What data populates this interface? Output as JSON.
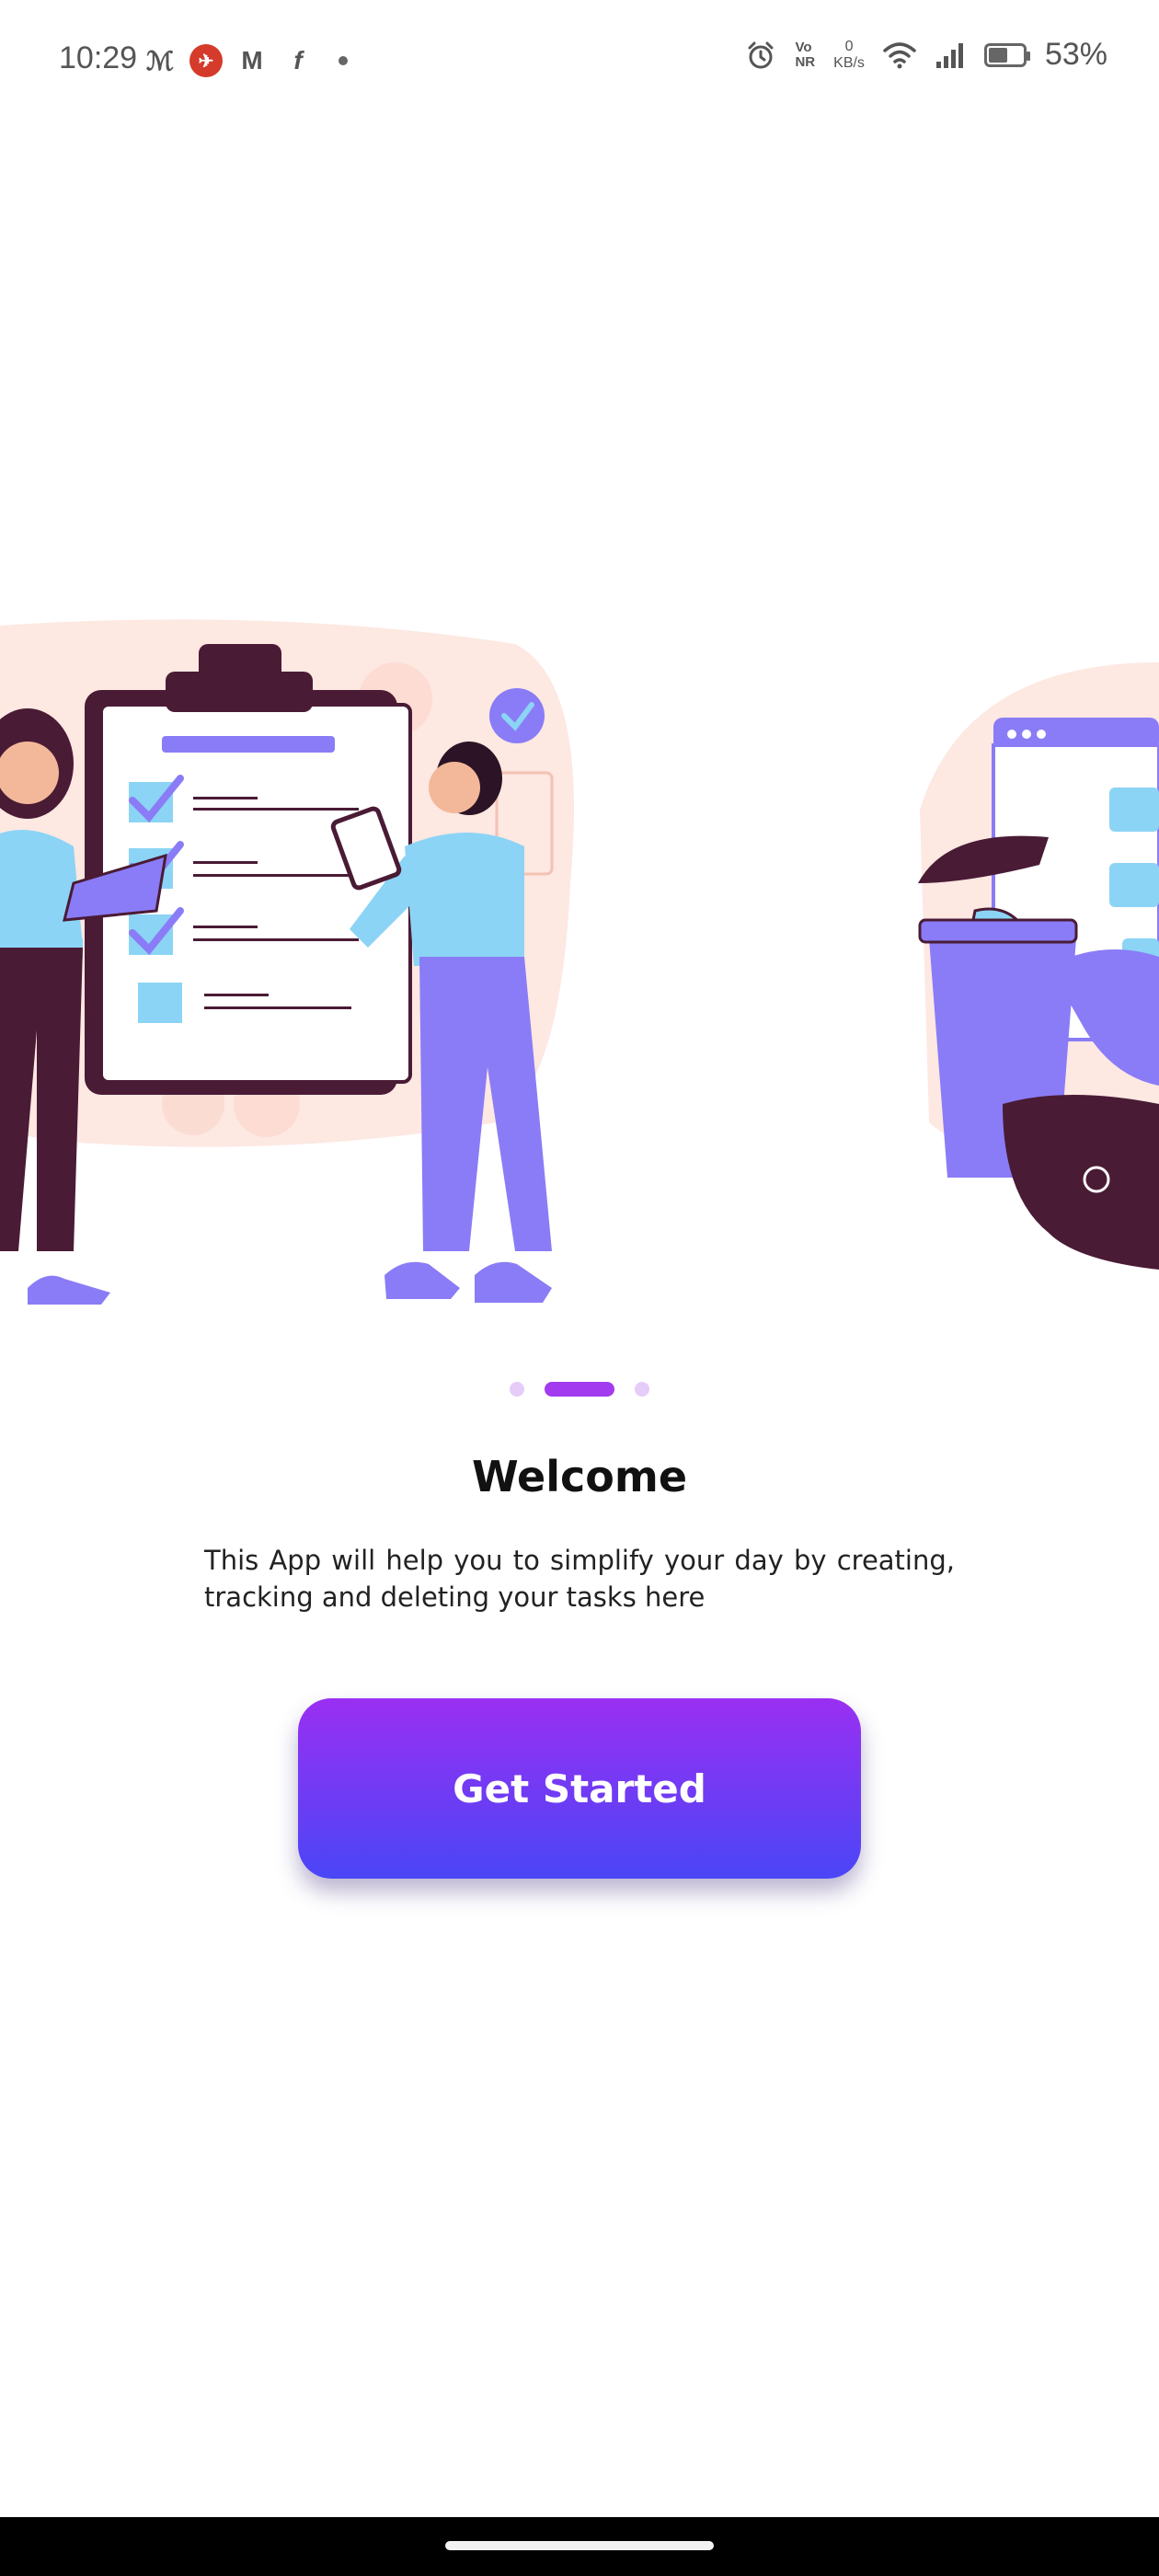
{
  "status_bar": {
    "time": "10:29",
    "app_icons": [
      {
        "name": "myntra-like-icon",
        "glyph": "ℳ",
        "color": "#555555"
      },
      {
        "name": "red-app-icon",
        "glyph": "✈",
        "color": "#d43b2a"
      },
      {
        "name": "m-app-icon",
        "glyph": "M",
        "color": "#555555"
      },
      {
        "name": "flipkart-icon",
        "glyph": "f",
        "color": "#555555"
      }
    ],
    "volte_top": "Vo",
    "volte_bottom": "NR",
    "net_speed_value": "0",
    "net_speed_unit": "KB/s",
    "battery_percent": "53%"
  },
  "onboarding": {
    "page_count": 3,
    "active_page": 2,
    "title": "Welcome",
    "description": "This App will help you to simplify your day by creating, tracking and deleting your tasks here",
    "cta_label": "Get Started"
  },
  "colors": {
    "accent": "#a23bef",
    "accent_light": "#e6ccf9",
    "button_top": "#9a2ff2",
    "button_bottom": "#4a46f6",
    "illustration_purple": "#8a7cf6",
    "illustration_blue": "#8cd4f5",
    "illustration_dark": "#4a1b35",
    "illustration_peach": "#fde8e2"
  }
}
